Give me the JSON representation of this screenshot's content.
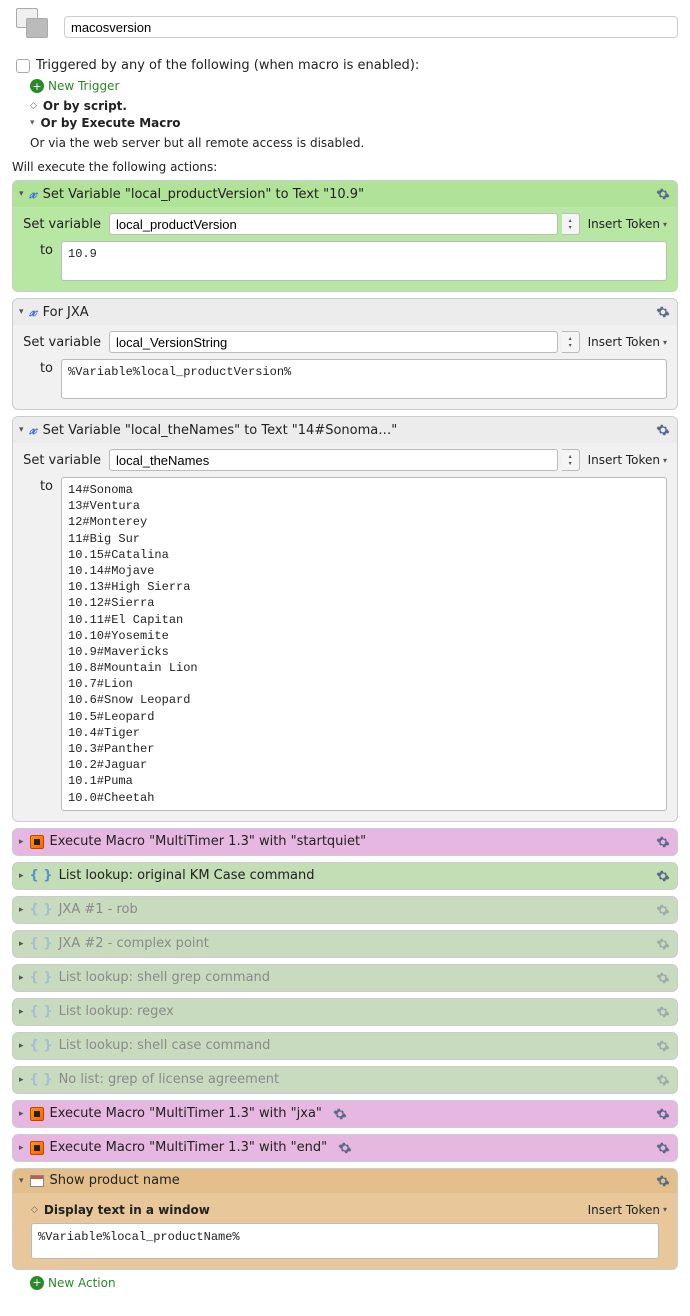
{
  "header": {
    "macro_name": "macosversion"
  },
  "triggers": {
    "triggered_by": "Triggered by any of the following (when macro is enabled):",
    "new_trigger": "New Trigger",
    "or_script": "Or by script.",
    "or_execute": "Or by Execute Macro",
    "or_web": "Or via the web server but all remote access is disabled."
  },
  "execute_label": "Will execute the following actions:",
  "labels": {
    "set_variable": "Set variable",
    "to": "to",
    "insert_token": "Insert Token"
  },
  "action1": {
    "title": "Set Variable \"local_productVersion\" to Text \"10.9\"",
    "var_name": "local_productVersion",
    "value": "10.9"
  },
  "action2": {
    "title": "For JXA",
    "var_name": "local_VersionString",
    "value": "%Variable%local_productVersion%"
  },
  "action3": {
    "title": "Set Variable \"local_theNames\" to Text \"14#Sonoma…\"",
    "var_name": "local_theNames",
    "value": "14#Sonoma\n13#Ventura\n12#Monterey\n11#Big Sur\n10.15#Catalina\n10.14#Mojave\n10.13#High Sierra\n10.12#Sierra\n10.11#El Capitan\n10.10#Yosemite\n10.9#Mavericks\n10.8#Mountain Lion\n10.7#Lion\n10.6#Snow Leopard\n10.5#Leopard\n10.4#Tiger\n10.3#Panther\n10.2#Jaguar\n10.1#Puma\n10.0#Cheetah"
  },
  "collapsed": {
    "c1": "Execute Macro \"MultiTimer 1.3\" with \"startquiet\"",
    "c2": "List lookup: original KM Case command",
    "c3": "JXA #1 - rob",
    "c4": "JXA #2 - complex point",
    "c5": "List lookup: shell grep command",
    "c6": "List lookup: regex",
    "c7": "List lookup: shell case command",
    "c8": "No list: grep of license agreement",
    "c9": "Execute Macro \"MultiTimer 1.3\" with \"jxa\"",
    "c10": "Execute Macro \"MultiTimer 1.3\" with \"end\""
  },
  "show_action": {
    "title": "Show product name",
    "display_label": "Display text in a window",
    "value": "%Variable%local_productName%"
  },
  "footer": {
    "new_action": "New Action"
  }
}
